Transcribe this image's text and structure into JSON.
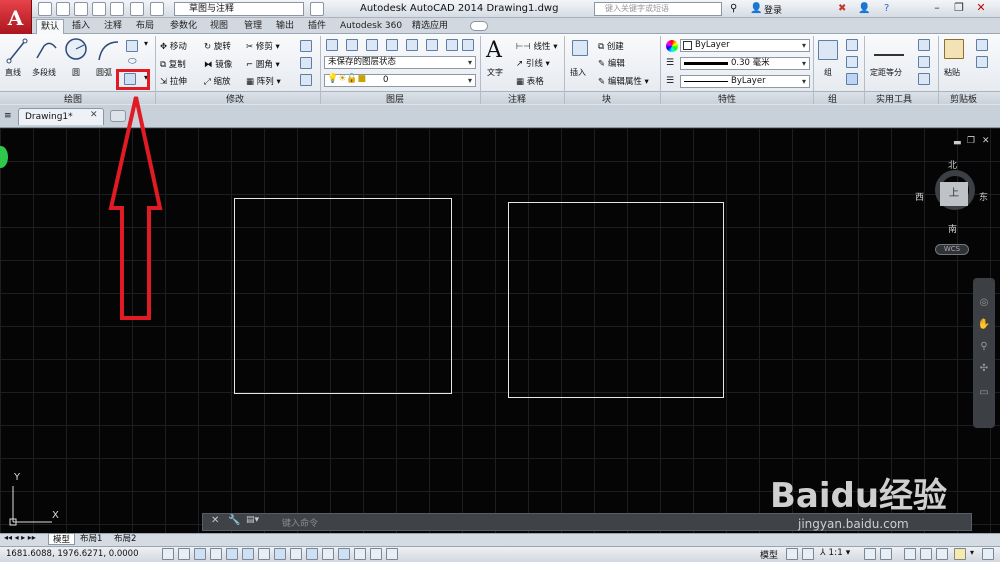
{
  "titlebar": {
    "logo_letter": "A",
    "workspace": "草图与注释",
    "app_title": "Autodesk AutoCAD 2014    Drawing1.dwg",
    "search_placeholder": "键入关键字或短语",
    "login_label": "登录"
  },
  "tabs": [
    "默认",
    "插入",
    "注释",
    "布局",
    "参数化",
    "视图",
    "管理",
    "输出",
    "插件",
    "Autodesk 360",
    "精选应用"
  ],
  "ribbon": {
    "draw": {
      "title": "绘图",
      "line": "直线",
      "polyline": "多段线",
      "circle": "圆",
      "arc": "圆弧"
    },
    "modify": {
      "title": "修改",
      "move": "移动",
      "rotate": "旋转",
      "trim": "修剪",
      "copy": "复制",
      "mirror": "镜像",
      "fillet": "圆角",
      "stretch": "拉伸",
      "scale": "缩放",
      "array": "阵列"
    },
    "layers": {
      "title": "图层",
      "layer_state": "未保存的图层状态",
      "current_layer": "0"
    },
    "annotation": {
      "title": "注释",
      "text": "文字",
      "dimension": "线性",
      "leader": "引线",
      "table": "表格"
    },
    "block": {
      "title": "块",
      "insert": "插入",
      "create": "创建",
      "edit": "编辑",
      "edit_attributes": "编辑属性"
    },
    "properties": {
      "title": "特性",
      "color": "ByLayer",
      "lineweight": "0.30 毫米",
      "linetype": "ByLayer"
    },
    "groups": {
      "title": "组",
      "group": "组"
    },
    "utilities": {
      "title": "实用工具",
      "measure": "定距等分"
    },
    "clipboard": {
      "title": "剪贴板",
      "paste": "粘贴"
    }
  },
  "document": {
    "tab_label": "Drawing1*"
  },
  "viewcube": {
    "north": "北",
    "south": "南",
    "east": "东",
    "west": "西",
    "top": "上",
    "wcs": "WCS"
  },
  "ucs": {
    "y_label": "Y",
    "x_label": "X"
  },
  "command_line": {
    "placeholder": "键入命令"
  },
  "layout_tabs": [
    "模型",
    "布局1",
    "布局2"
  ],
  "status": {
    "coordinates": "1681.6088, 1976.6271, 0.0000",
    "model_label": "模型",
    "scale": "1:1"
  },
  "watermark": {
    "brand": "Baidu经验",
    "url": "jingyan.baidu.com"
  }
}
